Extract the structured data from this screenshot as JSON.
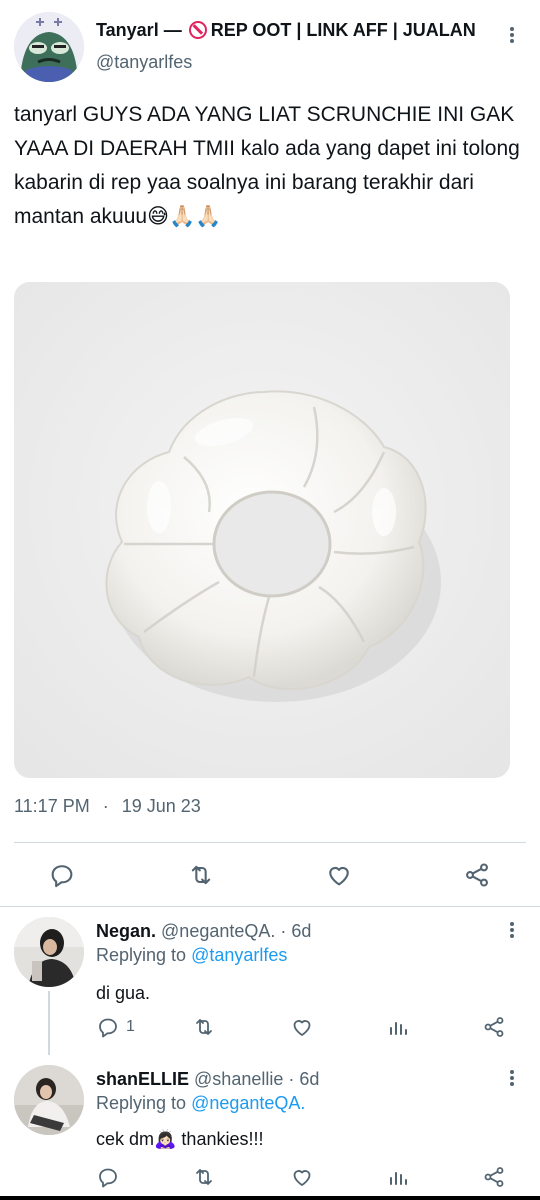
{
  "tweet": {
    "display_name_prefix": "Tanyarl — ",
    "display_name_suffix": "REP OOT | LINK AFF | JUALAN",
    "handle": "@tanyarlfes",
    "text": "tanyarl GUYS ADA YANG LIAT SCRUNCHIE INI GAK YAAA DI DAERAH TMII kalo ada yang dapet ini tolong kabarin di rep yaa soalnya ini barang terakhir dari mantan akuuu😅🙏🏻🙏🏻",
    "time": "11:17 PM",
    "separator": "·",
    "date": "19 Jun 23",
    "icons": [
      "reply-icon",
      "retweet-icon",
      "like-icon",
      "share-icon",
      "more-icon"
    ]
  },
  "replies": [
    {
      "name": "Negan.",
      "handle": "@neganteQA.",
      "age": " · 6d",
      "replying_label": "Replying to ",
      "replying_to": "@tanyarlfes",
      "text": "di gua.",
      "reply_count": "1"
    },
    {
      "name": "shanELLIE",
      "handle": "@shanellie",
      "age": " · 6d",
      "replying_label": "Replying to ",
      "replying_to": "@neganteQA.",
      "text": "cek dm🙇🏻‍♀️ thankies!!!",
      "reply_count": ""
    }
  ],
  "colors": {
    "accent": "#1d9bf0",
    "text": "#0f1419",
    "secondary": "#536471",
    "divider": "#cfd9de",
    "no_entry": "#e0245e"
  }
}
